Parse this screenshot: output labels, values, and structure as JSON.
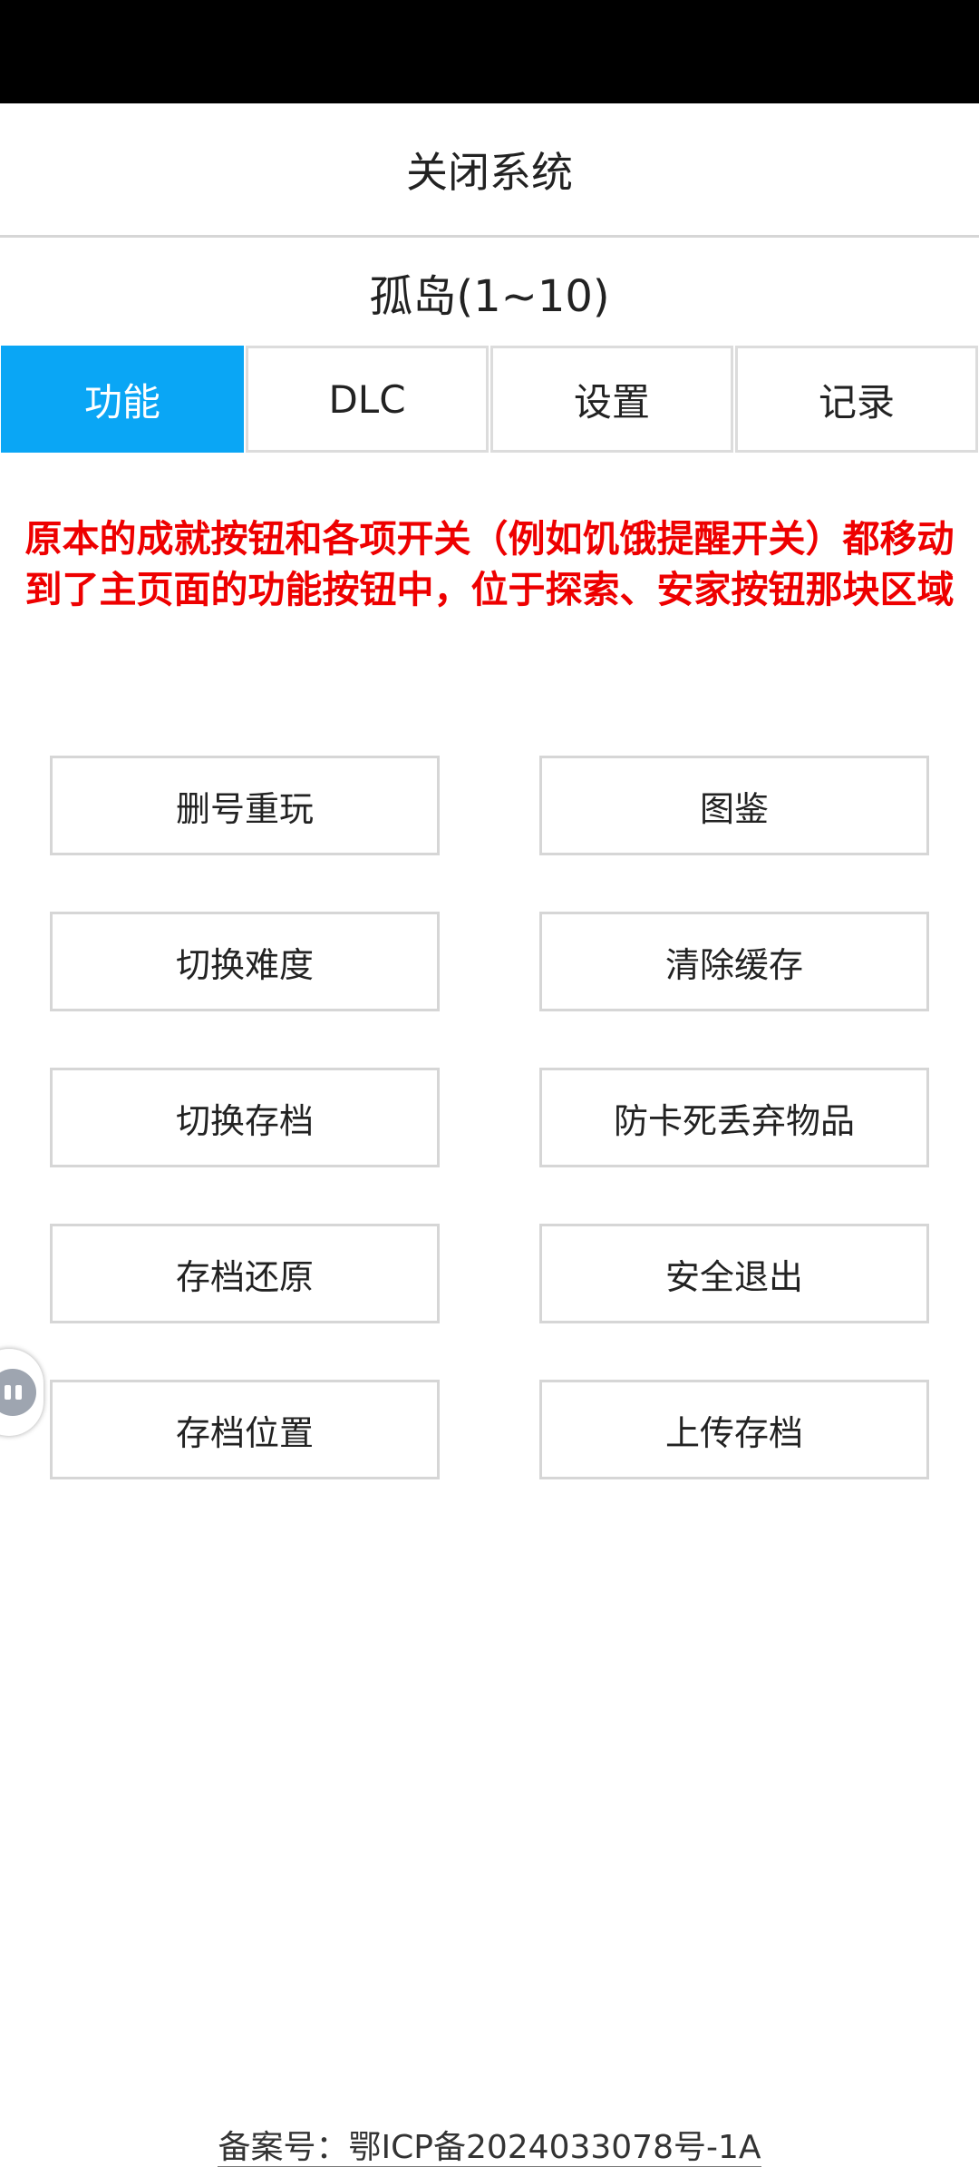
{
  "header": {
    "close_label": "关闭系统"
  },
  "game": {
    "title": "孤岛(1~10)"
  },
  "tabs": [
    {
      "label": "功能",
      "active": true
    },
    {
      "label": "DLC",
      "active": false
    },
    {
      "label": "设置",
      "active": false
    },
    {
      "label": "记录",
      "active": false
    }
  ],
  "notice": {
    "text": "原本的成就按钮和各项开关（例如饥饿提醒开关）都移动到了主页面的功能按钮中，位于探索、安家按钮那块区域",
    "color": "#ee0000"
  },
  "buttons": {
    "delete_replay": "删号重玩",
    "encyclopedia": "图鉴",
    "switch_difficulty": "切换难度",
    "clear_cache": "清除缓存",
    "switch_save": "切换存档",
    "anti_freeze_drop": "防卡死丢弃物品",
    "restore_save": "存档还原",
    "safe_exit": "安全退出",
    "save_location": "存档位置",
    "upload_save": "上传存档"
  },
  "footer": {
    "icp": "备案号：鄂ICP备2024033078号-1A"
  },
  "colors": {
    "accent": "#0aa6f5",
    "border": "#d6d6d6"
  },
  "icons": {
    "floating": "floating-assistant-icon"
  }
}
